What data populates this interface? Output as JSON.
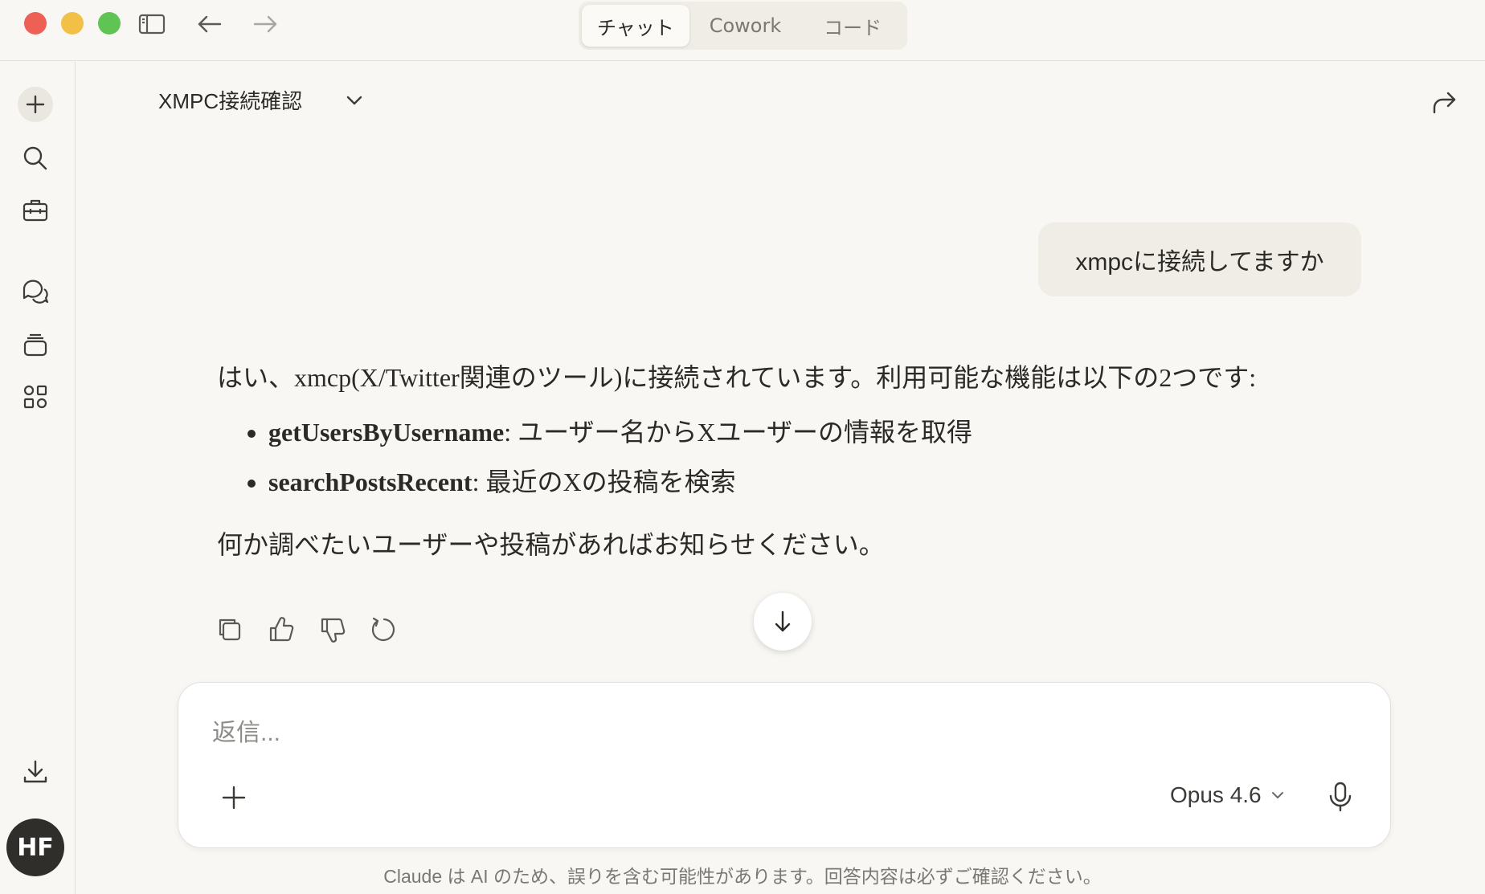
{
  "window": {
    "tabs": [
      {
        "label": "チャット",
        "active": true
      },
      {
        "label": "Cowork",
        "active": false
      },
      {
        "label": "コード",
        "active": false
      }
    ]
  },
  "sidebar": {
    "items": [
      "new-chat",
      "search",
      "tools",
      "chats",
      "projects",
      "artifacts",
      "download"
    ],
    "avatar_initials": "HF"
  },
  "conversation": {
    "title": "XMPC接続確認",
    "user_message": "xmpcに接続してますか",
    "assistant": {
      "intro": "はい、xmcp(X/Twitter関連のツール)に接続されています。利用可能な機能は以下の2つです:",
      "tools": [
        {
          "name": "getUsersByUsername",
          "desc": " ユーザー名からXユーザーの情報を取得"
        },
        {
          "name": "searchPostsRecent",
          "desc": " 最近のXの投稿を検索"
        }
      ],
      "closing": "何か調べたいユーザーや投稿があればお知らせください。"
    }
  },
  "composer": {
    "placeholder": "返信...",
    "model": "Opus 4.6"
  },
  "footer": {
    "disclaimer": "Claude は AI のため、誤りを含む可能性があります。回答内容は必ずご確認ください。"
  },
  "colors": {
    "background": "#f8f7f3",
    "bubble": "#efede6",
    "avatar": "#2f2e2b"
  }
}
